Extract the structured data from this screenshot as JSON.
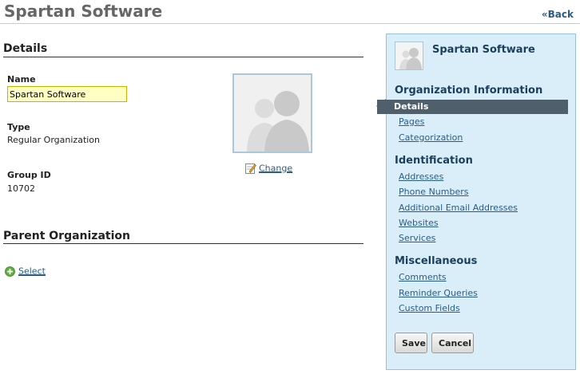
{
  "header": {
    "title": "Spartan Software",
    "back_label": "«Back"
  },
  "details": {
    "heading": "Details",
    "name": {
      "label": "Name",
      "value": "Spartan Software"
    },
    "type": {
      "label": "Type",
      "value": "Regular Organization"
    },
    "group_id": {
      "label": "Group ID",
      "value": "10702"
    },
    "change_label": "Change"
  },
  "parent": {
    "heading": "Parent Organization",
    "select_label": "Select"
  },
  "sidebar": {
    "org_name": "Spartan Software",
    "sections": [
      {
        "heading": "Organization Information",
        "items": [
          "Details",
          "Pages",
          "Categorization"
        ]
      },
      {
        "heading": "Identification",
        "items": [
          "Addresses",
          "Phone Numbers",
          "Additional Email Addresses",
          "Websites",
          "Services"
        ]
      },
      {
        "heading": "Miscellaneous",
        "items": [
          "Comments",
          "Reminder Queries",
          "Custom Fields"
        ]
      }
    ],
    "save_label": "Save",
    "cancel_label": "Cancel"
  },
  "colors": {
    "accent": "#2a5d84",
    "sidebar_bg": "#d9eef9",
    "active_item_bg": "#4f5f6c",
    "input_highlight": "#ffffc4"
  }
}
